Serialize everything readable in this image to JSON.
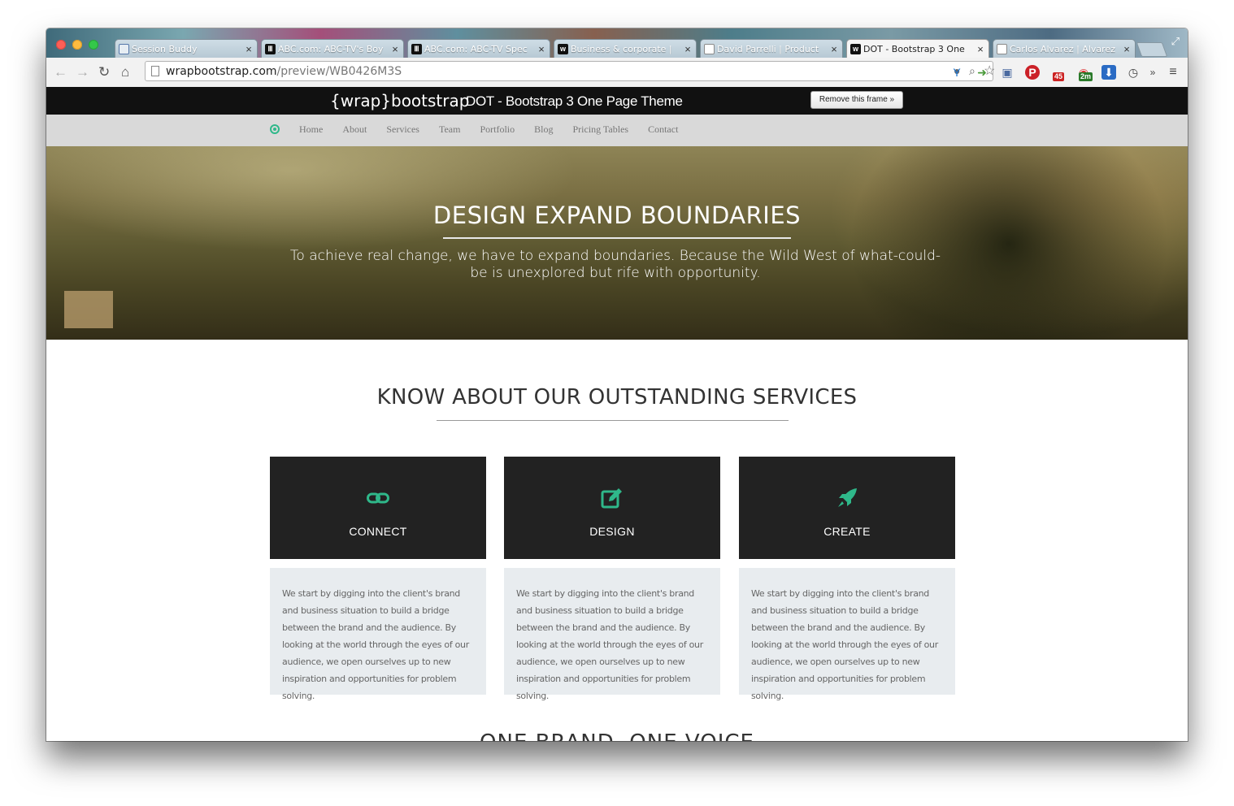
{
  "browser": {
    "tabs": [
      {
        "title": "Session Buddy",
        "favicon": "window-icon"
      },
      {
        "title": "ABC.com: ABC-TV's Boy",
        "favicon": "building-icon"
      },
      {
        "title": "ABC.com: ABC-TV Spec",
        "favicon": "building-icon"
      },
      {
        "title": "Business & corporate | ",
        "favicon": "w-icon"
      },
      {
        "title": "David Parrelli | Product",
        "favicon": "doc-icon"
      },
      {
        "title": "DOT - Bootstrap 3 One",
        "favicon": "w-icon",
        "active": true
      },
      {
        "title": "Carlos Alvarez | Alvarez",
        "favicon": "doc-icon"
      }
    ],
    "url_host": "wrapbootstrap.com",
    "url_path": "/preview/WB0426M3S",
    "badges": {
      "ext_a": "45",
      "ext_b": "2m"
    },
    "overflow_label": "»"
  },
  "frame": {
    "logo_braces_open": "{",
    "logo_wrap": "wrap",
    "logo_braces_close": "}",
    "logo_rest": "bootstrap",
    "title": "DOT - Bootstrap 3 One Page Theme",
    "remove_button": "Remove this frame »"
  },
  "site": {
    "nav": [
      "Home",
      "About",
      "Services",
      "Team",
      "Portfolio",
      "Blog",
      "Pricing Tables",
      "Contact"
    ],
    "accent": "#2fb88a",
    "hero": {
      "title": "DESIGN EXPAND BOUNDARIES",
      "subtitle": "To achieve real change, we have to expand boundaries. Because the Wild West of what-could-be is unexplored but rife with opportunity."
    },
    "services": {
      "title": "KNOW ABOUT OUR OUTSTANDING SERVICES",
      "cards": [
        {
          "label": "CONNECT",
          "icon": "link-icon",
          "text": "We start by digging into the client's brand and business situation to build a bridge between the brand and the audience. By looking at the world through the eyes of our audience, we open ourselves up to new inspiration and opportunities for problem solving."
        },
        {
          "label": "DESIGN",
          "icon": "edit-icon",
          "text": "We start by digging into the client's brand and business situation to build a bridge between the brand and the audience. By looking at the world through the eyes of our audience, we open ourselves up to new inspiration and opportunities for problem solving."
        },
        {
          "label": "CREATE",
          "icon": "rocket-icon",
          "text": "We start by digging into the client's brand and business situation to build a bridge between the brand and the audience. By looking at the world through the eyes of our audience, we open ourselves up to new inspiration and opportunities for problem solving."
        }
      ]
    },
    "next_section_title": "ONE BRAND, ONE VOICE"
  }
}
